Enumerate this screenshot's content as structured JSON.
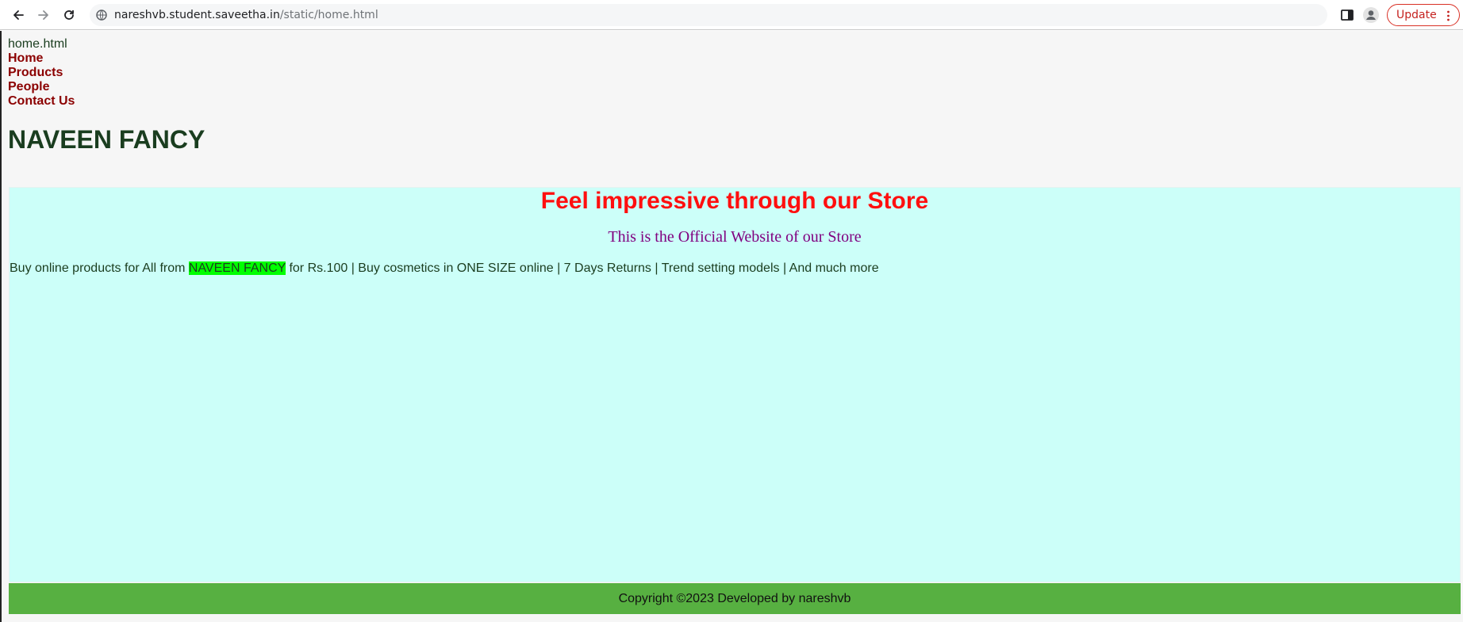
{
  "browser": {
    "url_host": "nareshvb.student.saveetha.in",
    "url_path": "/static/home.html",
    "update_label": "Update"
  },
  "page": {
    "filename": "home.html",
    "menu": [
      {
        "label": "Home"
      },
      {
        "label": "Products"
      },
      {
        "label": "People"
      },
      {
        "label": "Contact Us"
      }
    ],
    "brand": "NAVEEN FANCY",
    "hero": {
      "title": "Feel impressive through our Store",
      "subtitle": "This is the Official Website of our Store",
      "text_before": "Buy online products for All from ",
      "highlight": "NAVEEN FANCY",
      "text_after": " for Rs.100 | Buy cosmetics in ONE SIZE online | 7 Days Returns | Trend setting models | And much more"
    },
    "footer": "Copyright ©2023 Developed by nareshvb"
  },
  "colors": {
    "menu_link": "#8b0000",
    "brand": "#1a3d1f",
    "hero_bg": "#ccfff9",
    "hero_title": "#ff0f0f",
    "hero_subtitle": "#800080",
    "highlight_bg": "#00ff00",
    "footer_bg": "#57b041",
    "update_accent": "#c5221f"
  }
}
